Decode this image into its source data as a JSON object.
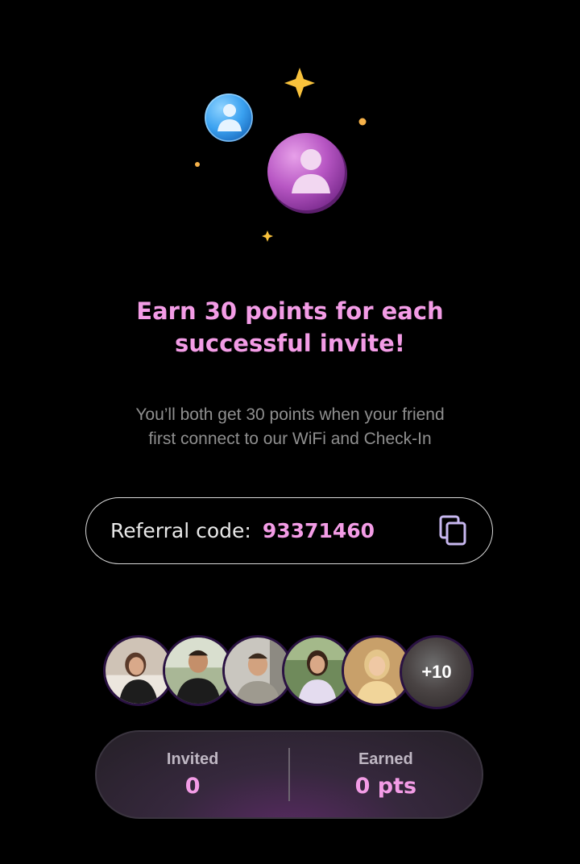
{
  "headline": {
    "line1": "Earn 30 points for each",
    "line2": "successful invite!"
  },
  "subtitle": {
    "line1": "You’ll both get 30 points when your friend",
    "line2": "first connect to our WiFi and Check-In"
  },
  "referral": {
    "label": "Referral code:",
    "code": "93371460",
    "copy_icon": "copy-icon"
  },
  "avatars": {
    "more_label": "+10"
  },
  "stats": {
    "invited_label": "Invited",
    "invited_value": "0",
    "earned_label": "Earned",
    "earned_value": "0 pts"
  },
  "colors": {
    "accent": "#f39ce6",
    "background": "#000000",
    "muted_text": "#8f8f8f"
  }
}
